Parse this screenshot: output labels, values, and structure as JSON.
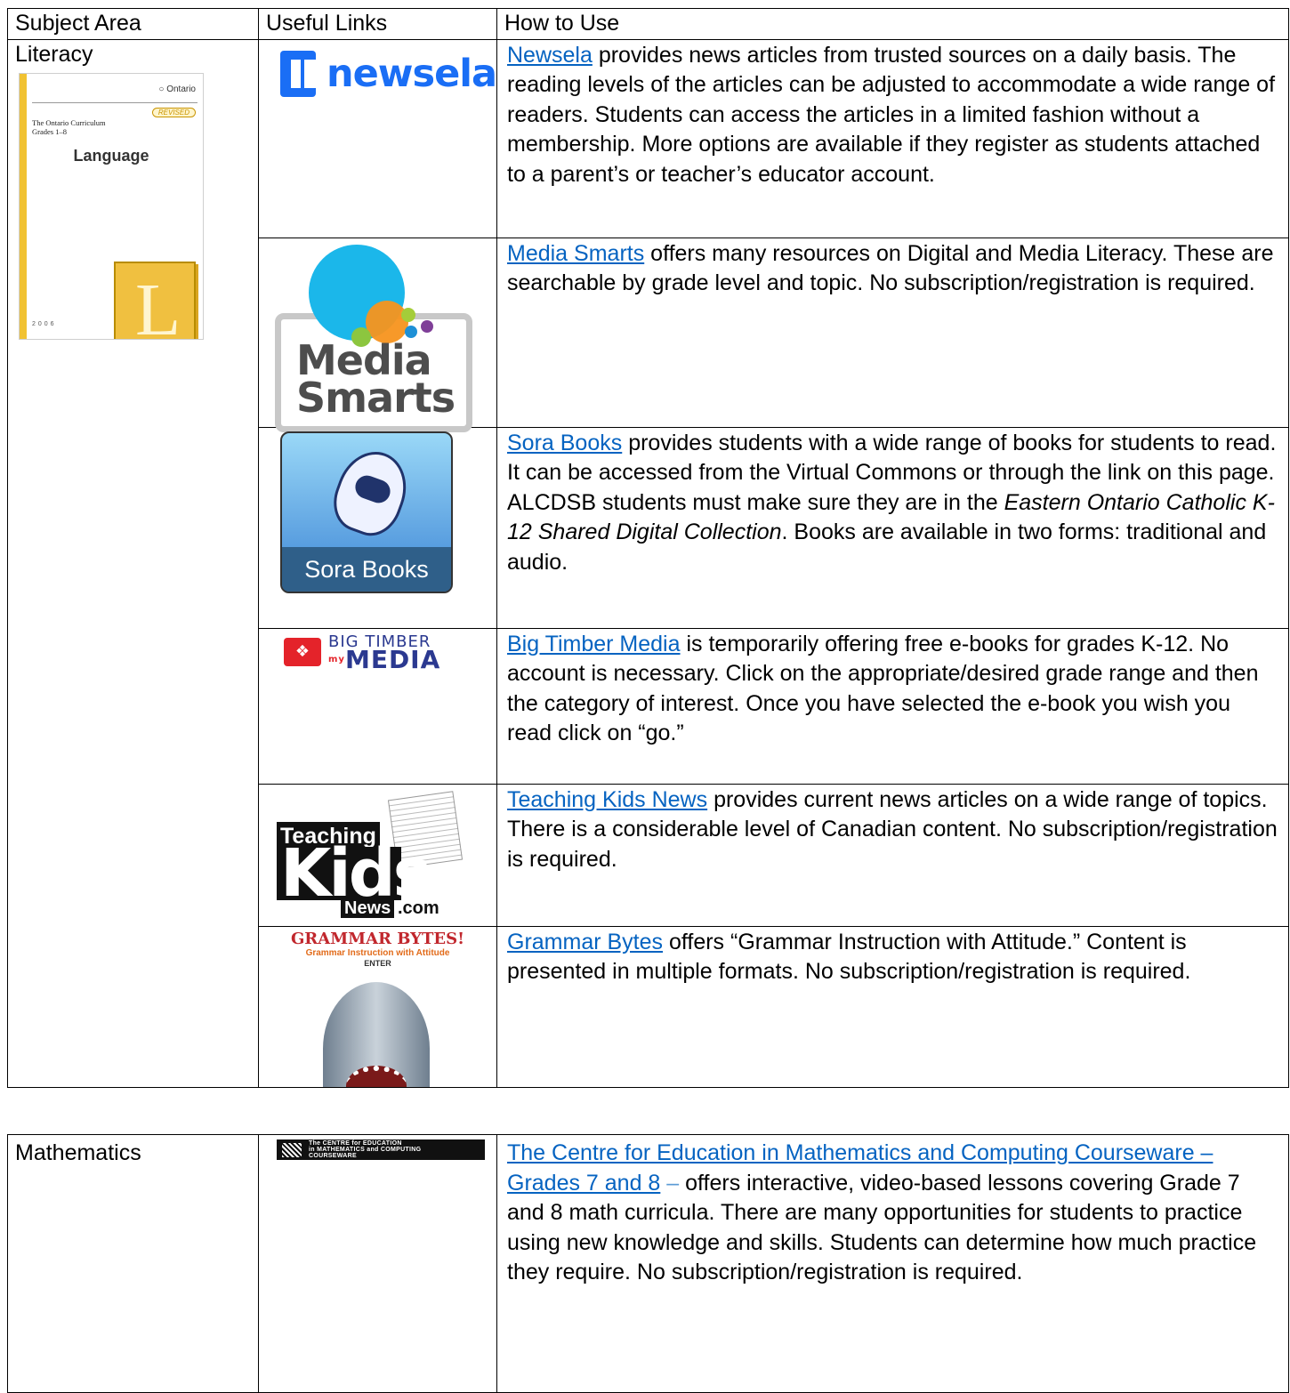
{
  "header": {
    "subject_area": "Subject Area",
    "useful_links": "Useful Links",
    "how_to_use": "How to Use"
  },
  "literacy": {
    "subject": "Literacy",
    "cover": {
      "ministry": "Ontario",
      "revised": "REVISED",
      "curriculum_line1": "The Ontario Curriculum",
      "curriculum_line2": "Grades 1–8",
      "title": "Language",
      "letter": "L",
      "year": "2006"
    },
    "rows": [
      {
        "logo_text": "newsela",
        "link": "Newsela",
        "text": " provides news articles from trusted sources on a daily basis. The reading levels of the articles can be adjusted to accommodate a wide range of readers. Students can access the articles in a limited fashion without a membership. More options are available if they register as students attached to a parent’s or teacher’s educator account."
      },
      {
        "logo_line1": "Media",
        "logo_line2": "Smarts",
        "link": "Media Smarts",
        "text": " offers many resources on Digital and Media Literacy. These are searchable by grade level and topic. No subscription/registration is required."
      },
      {
        "logo_text": "Sora Books",
        "link": "Sora Books",
        "text_before": " provides students with a wide range of books for students to read. It can be accessed from the Virtual Commons or through the link on this page. ALCDSB students must make sure they are in the ",
        "text_italic": "Eastern Ontario Catholic K-12 Shared Digital Collection",
        "text_after": ". Books are available in two forms: traditional and audio."
      },
      {
        "logo_line1": "BIG TIMBER",
        "logo_my": "my",
        "logo_line2": "MEDIA",
        "link": "Big Timber Media",
        "text": " is temporarily offering free e-books for grades K-12. No account is necessary.  Click on the appropriate/desired grade range and then the category of interest. Once you have selected the e-book you wish you read click on “go.”"
      },
      {
        "logo_line1": "Teaching",
        "logo_line2": "Kids",
        "logo_line3": "News",
        "logo_line4": ".com",
        "link": "Teaching Kids News",
        "text": " provides current news articles on a wide range of topics. There is a considerable level of Canadian content. No subscription/registration is required."
      },
      {
        "logo_line1": "GRAMMAR BYTES!",
        "logo_line2": "Grammar Instruction with Attitude",
        "logo_line3": "ENTER",
        "link": "Grammar Bytes",
        "text": " offers “Grammar Instruction with Attitude.” Content is presented in multiple formats. No subscription/registration is required."
      }
    ]
  },
  "mathematics": {
    "subject": "Mathematics",
    "logo_line1": "The CENTRE for EDUCATION",
    "logo_line2": "in MATHEMATICS and COMPUTING",
    "logo_line3": "COURSEWARE",
    "link": "The Centre for Education in Mathematics and Computing Courseware – Grades 7 and 8",
    "dash": " – ",
    "text": "offers interactive, video-based lessons covering Grade 7 and 8 math curricula. There are many opportunities for students to practice using new knowledge and skills. Students can determine how much practice they require. No subscription/registration is required."
  }
}
